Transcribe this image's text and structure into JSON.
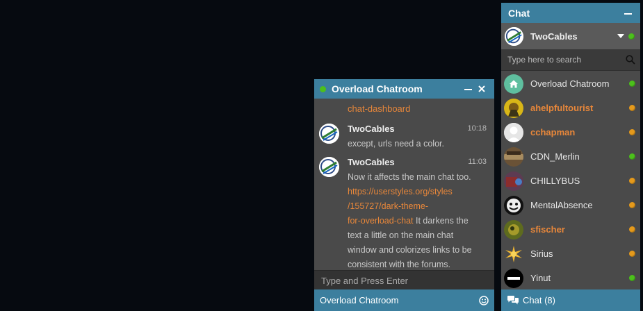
{
  "room": {
    "title": "Overload Chatroom",
    "previous_link_tail": "chat-dashboard",
    "messages": [
      {
        "author": "TwoCables",
        "time": "10:18",
        "text": "except, urls need a color."
      },
      {
        "author": "TwoCables",
        "time": "11:03",
        "text_before": "Now it affects the main chat too.",
        "link": "https://userstyles.org/styles/155727/dark-theme-for-overload-chat",
        "link_line1": "https://userstyles.org/styles",
        "link_line2": "/155727/dark-theme-",
        "link_line3": "for-overload-chat",
        "text_after": " It darkens the text a little on the main chat window and colorizes links to be consistent with the forums."
      }
    ],
    "input_placeholder": "Type and Press Enter",
    "footer_label": "Overload Chatroom"
  },
  "panel": {
    "title": "Chat",
    "current_user": "TwoCables",
    "search_placeholder": "Type here to search",
    "contacts": [
      {
        "name": "Overload Chatroom",
        "status": "online",
        "avatar": "home-icon"
      },
      {
        "name": "ahelpfultourist",
        "status": "away",
        "avatar": "avatar"
      },
      {
        "name": "cchapman",
        "status": "away",
        "avatar": "default-user-icon"
      },
      {
        "name": "CDN_Merlin",
        "status": "online",
        "avatar": "avatar"
      },
      {
        "name": "CHILLYBUS",
        "status": "away",
        "avatar": "avatar"
      },
      {
        "name": "MentalAbsence",
        "status": "away",
        "avatar": "avatar"
      },
      {
        "name": "sfischer",
        "status": "away",
        "avatar": "avatar"
      },
      {
        "name": "Sirius",
        "status": "away",
        "avatar": "avatar"
      },
      {
        "name": "Yinut",
        "status": "online",
        "avatar": "avatar"
      }
    ],
    "footer_label": "Chat (8)"
  },
  "colors": {
    "accent": "#3c7f9e",
    "link": "#e8873a",
    "online": "#4cc01c",
    "away": "#e59a1c",
    "background": "#060a10"
  }
}
